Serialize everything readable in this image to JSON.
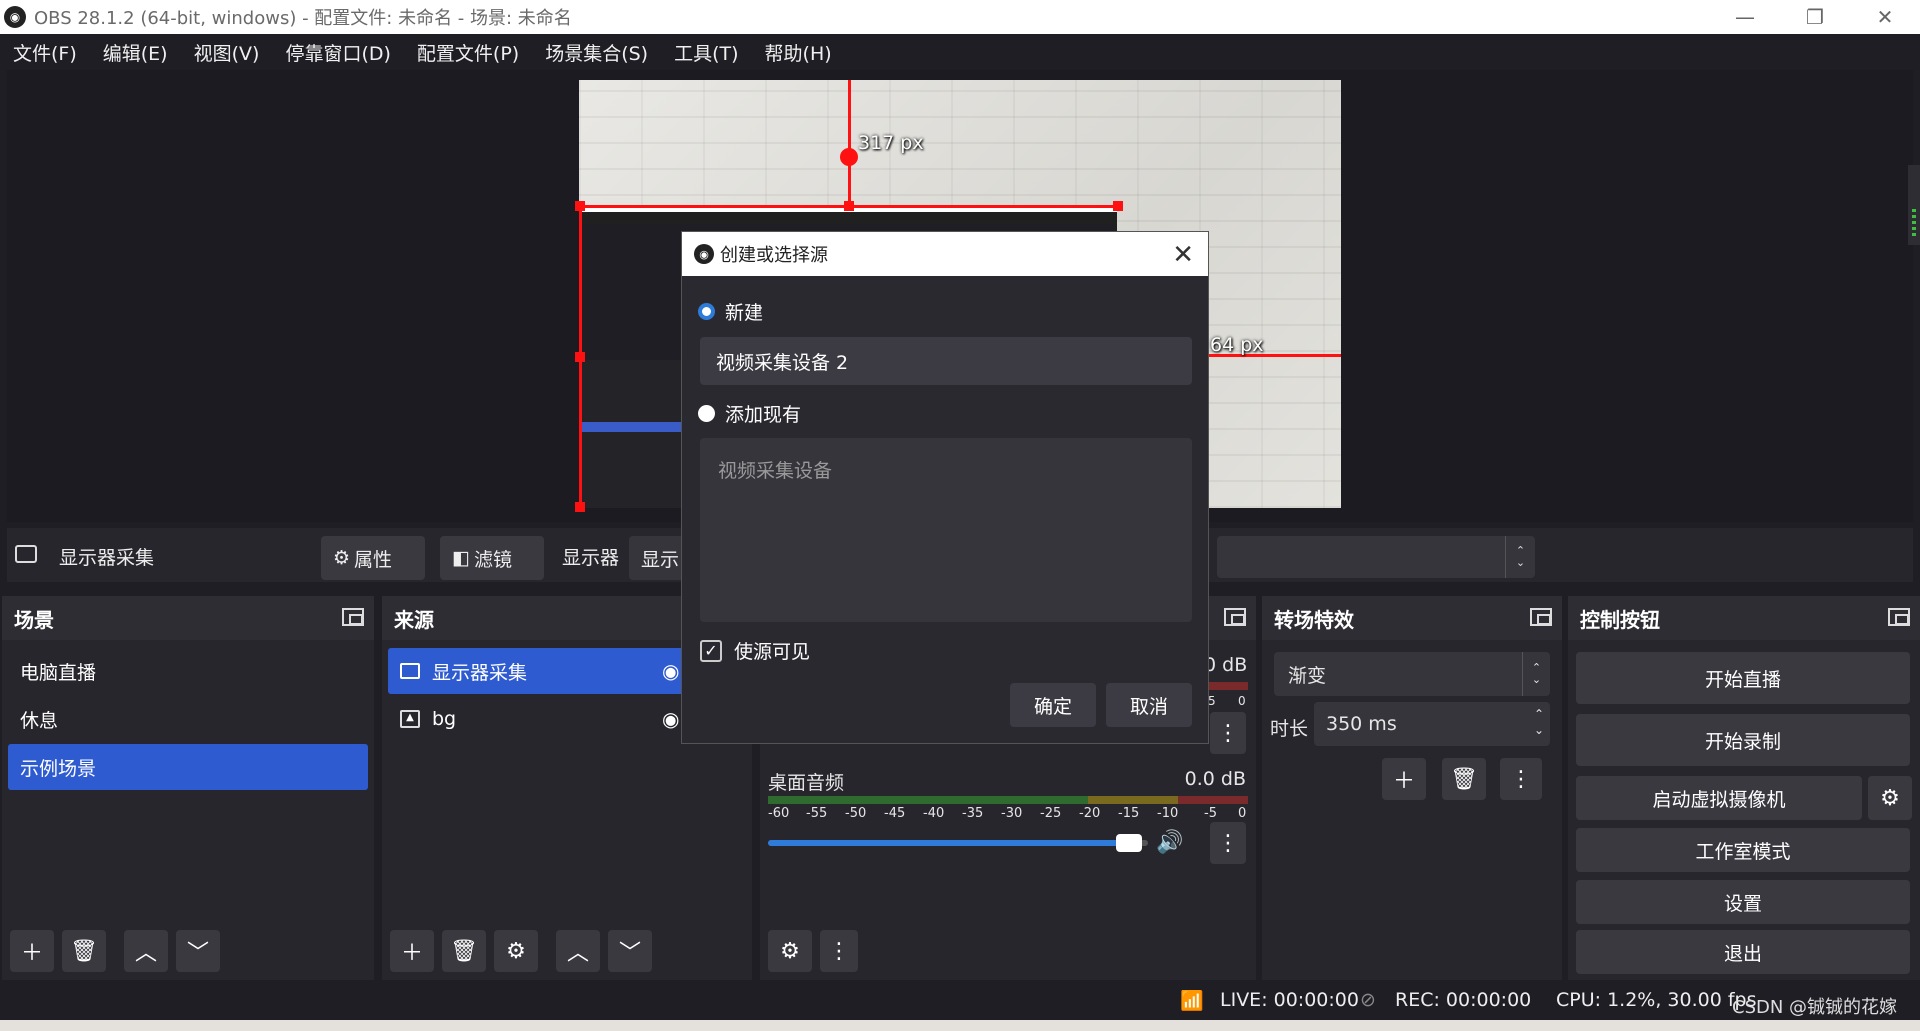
{
  "window": {
    "title": "OBS 28.1.2 (64-bit, windows) - 配置文件: 未命名 - 场景: 未命名",
    "min": "—",
    "max": "❐",
    "close": "✕"
  },
  "menu": [
    "文件(F)",
    "编辑(E)",
    "视图(V)",
    "停靠窗口(D)",
    "配置文件(P)",
    "场景集合(S)",
    "工具(T)",
    "帮助(H)"
  ],
  "preview": {
    "top_px": "317 px",
    "right_px": "64 px"
  },
  "dialog": {
    "title": "创建或选择源",
    "new_label": "新建",
    "new_name": "视频采集设备 2",
    "existing_label": "添加现有",
    "existing_items": [
      "视频采集设备"
    ],
    "visible_label": "使源可见",
    "ok": "确定",
    "cancel": "取消"
  },
  "source_toolbar": {
    "source_name": "显示器采集",
    "properties": "属性",
    "filters": "滤镜",
    "display_label": "显示器",
    "display_value": "显示"
  },
  "scenes": {
    "title": "场景",
    "items": [
      "电脑直播",
      "休息",
      "示例场景"
    ],
    "selected": 2
  },
  "sources": {
    "title": "来源",
    "items": [
      "显示器采集",
      "bg"
    ],
    "selected": 0
  },
  "mixer": {
    "track1_db": "0 dB",
    "track2_name": "桌面音频",
    "track2_db": "0.0 dB",
    "scale": [
      "-60",
      "-55",
      "-50",
      "-45",
      "-40",
      "-35",
      "-30",
      "-25",
      "-20",
      "-15",
      "-10",
      "-5",
      "0"
    ],
    "scale_tail": [
      "5",
      "0"
    ],
    "volume": 0.95
  },
  "transitions": {
    "title": "转场特效",
    "selected": "渐变",
    "duration_label": "时长",
    "duration": "350 ms"
  },
  "controls": {
    "title": "控制按钮",
    "start_stream": "开始直播",
    "start_record": "开始录制",
    "virtual_cam": "启动虚拟摄像机",
    "studio_mode": "工作室模式",
    "settings": "设置",
    "exit": "退出"
  },
  "status": {
    "live": "LIVE: 00:00:00",
    "rec": "REC: 00:00:00",
    "cpu": "CPU: 1.2%, 30.00 fps",
    "watermark": "CSDN @铖铖的花嫁"
  },
  "colors": {
    "accent": "#2f5bd0",
    "bg": "#1f1e25",
    "panel": "#27262d",
    "guide": "#ff1111"
  }
}
